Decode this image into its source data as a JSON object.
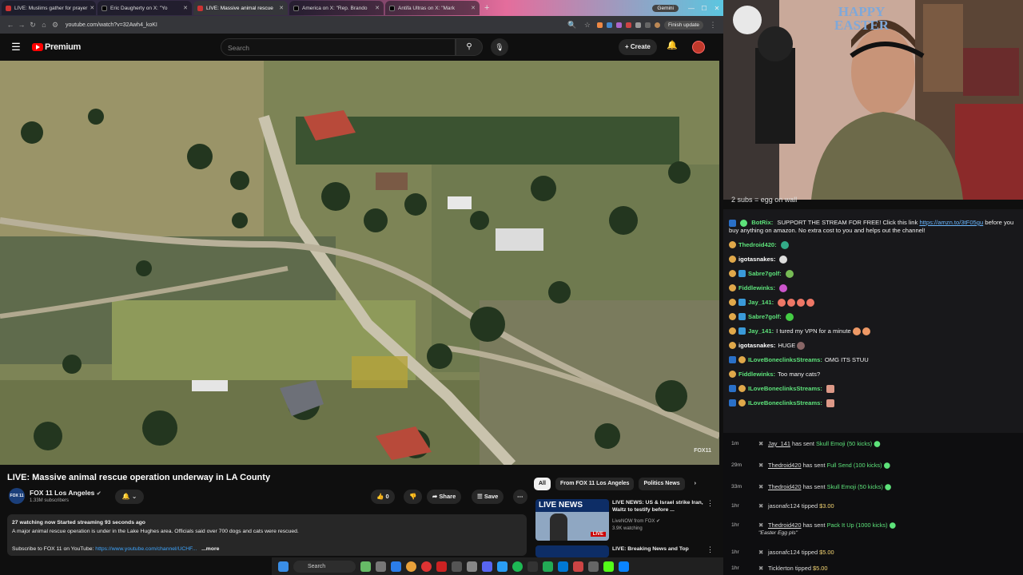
{
  "browser": {
    "tabs": [
      {
        "label": "LIVE: Muslims gather for prayer",
        "icon": "youtube-icon"
      },
      {
        "label": "Eric Daugherty on X: \"Yo",
        "icon": "x-icon"
      },
      {
        "label": "LIVE: Massive animal rescue",
        "icon": "youtube-icon",
        "active": true
      },
      {
        "label": "America on X: \"Rep. Brando",
        "icon": "x-icon"
      },
      {
        "label": "Antifa Ultras on X: \"Mark",
        "icon": "x-icon"
      }
    ],
    "new_tab": "+",
    "gemini_label": "Gemini",
    "url": "youtube.com/watch?v=32Awh4_koKI",
    "finish_update": "Finish update"
  },
  "youtube": {
    "logo": "Premium",
    "search_placeholder": "Search",
    "create_label": "Create"
  },
  "video": {
    "title": "LIVE: Massive animal rescue operation underway in LA County",
    "watermark": "FOX11",
    "channel_name": "FOX 11 Los Angeles",
    "channel_logo": "FOX 11",
    "subscribers": "1.33M subscribers",
    "likes": "0",
    "share_label": "Share",
    "save_label": "Save",
    "stats": "27 watching now  Started streaming 93 seconds ago",
    "description": "A major animal rescue operation is under in the Lake Hughes area.  Officials said over 700 dogs and cats were rescued.",
    "subscribe_prefix": "Subscribe to FOX 11 on YouTube: ",
    "subscribe_link": "https://www.youtube.com/channel/UCHF...",
    "more": "...more"
  },
  "recommendations": {
    "chips": [
      "All",
      "From FOX 11 Los Angeles",
      "Politics News"
    ],
    "items": [
      {
        "title": "LIVE NEWS: US & Israel strike Iran, Waltz to testify before ...",
        "channel": "LiveNOW from FOX",
        "meta": "3.9K watching",
        "thumb_text": "LIVE NEWS",
        "badge": "LIVE"
      },
      {
        "title": "LIVE: Breaking News and Top",
        "channel": "",
        "meta": "",
        "thumb_text": "",
        "badge": ""
      }
    ]
  },
  "stream": {
    "overlay_text": "2 subs = egg on wall",
    "chat": [
      {
        "user": "BotRix:",
        "color": "#5de27a",
        "text": "SUPPORT THE STREAM FOR FREE! Click this link ",
        "link": "https://amzn.to/3tF05gu",
        "text2": "before you buy anything on amazon. No extra cost to you and helps out the channel!"
      },
      {
        "user": "Thedroid420:",
        "color": "#5de27a",
        "text": ""
      },
      {
        "user": "igotasnakes:",
        "color": "#ffffff",
        "text": ""
      },
      {
        "user": "Sabre7golf:",
        "color": "#5de27a",
        "text": ""
      },
      {
        "user": "Fiddlewinks:",
        "color": "#5de27a",
        "text": ""
      },
      {
        "user": "Jay_141:",
        "color": "#5de27a",
        "text": ""
      },
      {
        "user": "Sabre7golf:",
        "color": "#5de27a",
        "text": ""
      },
      {
        "user": "Jay_141:",
        "color": "#5de27a",
        "text": "I tured my VPN for a minute"
      },
      {
        "user": "igotasnakes:",
        "color": "#ffffff",
        "text": "HUGE"
      },
      {
        "user": "ILoveBoneclinksStreams:",
        "color": "#5de27a",
        "text": "OMG ITS STUU"
      },
      {
        "user": "Fiddlewinks:",
        "color": "#5de27a",
        "text": "Too many cats?"
      },
      {
        "user": "ILoveBoneclinksStreams:",
        "color": "#5de27a",
        "text": ""
      },
      {
        "user": "ILoveBoneclinksStreams:",
        "color": "#5de27a",
        "text": ""
      }
    ],
    "events": [
      {
        "time": "1m",
        "name": "Jay_141",
        "action": " has sent ",
        "gift": "Skull Emoji (50 kicks)",
        "note": ""
      },
      {
        "time": "29m",
        "name": "Thedroid420",
        "action": " has sent ",
        "gift": "Full Send (100 kicks)",
        "note": ""
      },
      {
        "time": "33m",
        "name": "Thedroid420",
        "action": " has sent ",
        "gift": "Skull Emoji (50 kicks)",
        "note": ""
      },
      {
        "time": "1hr",
        "name": "jasonafc124",
        "action": " tipped ",
        "gift": "$3.00",
        "note": ""
      },
      {
        "time": "1hr",
        "name": "Thedroid420",
        "action": " has sent ",
        "gift": "Pack It Up (1000 kicks)",
        "note": "\"Easter Egg pls\""
      },
      {
        "time": "1hr",
        "name": "jasonafc124",
        "action": " tipped ",
        "gift": "$5.00",
        "note": ""
      },
      {
        "time": "1hr",
        "name": "Ticklerton",
        "action": " tipped ",
        "gift": "$5.00",
        "note": ""
      }
    ],
    "webcam_banner": "HAPPY EASTER"
  },
  "taskbar": {
    "search_label": "Search"
  },
  "colors": {
    "youtube_red": "#ff0000",
    "chat_bg": "#18181b",
    "kick_green": "#5de27a"
  }
}
